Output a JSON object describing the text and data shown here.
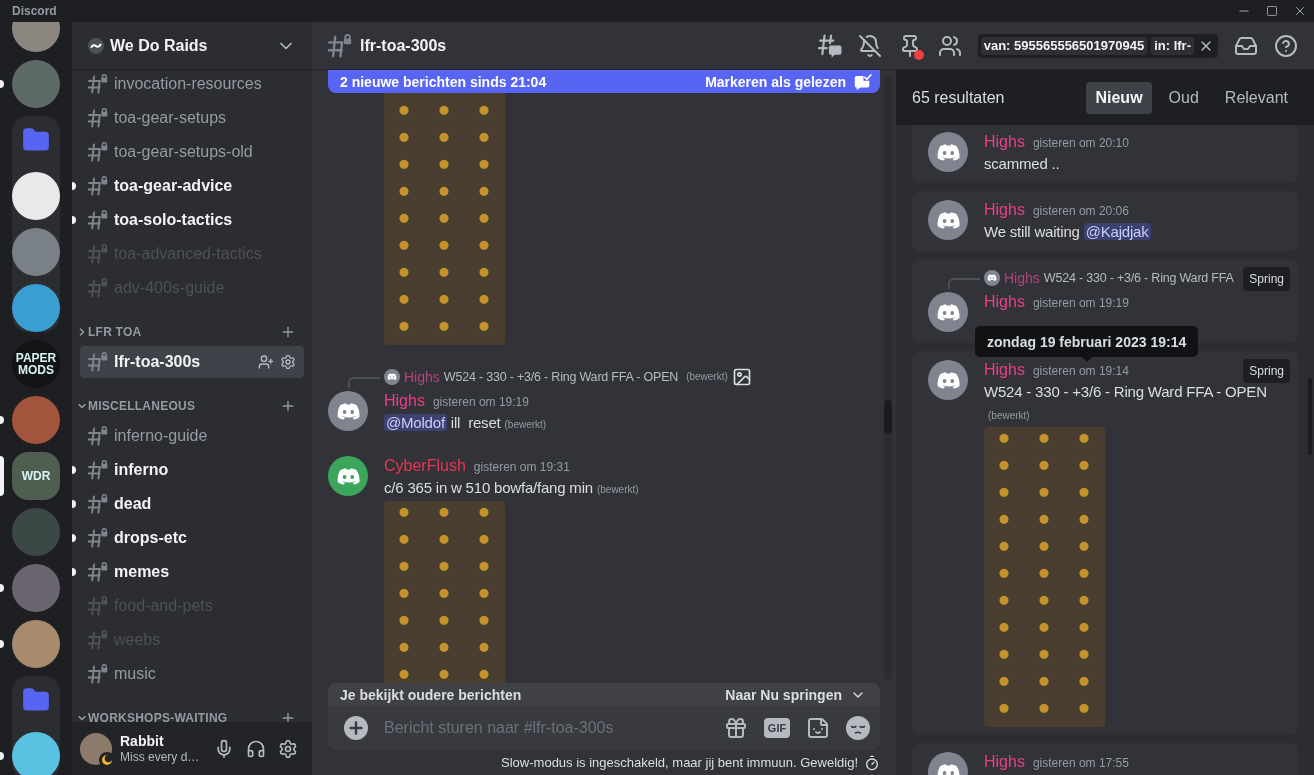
{
  "titlebar": {
    "app_name": "Discord"
  },
  "server_rail": [
    {
      "kind": "server",
      "color": "#8c8680",
      "unread": false,
      "selected": false
    },
    {
      "kind": "server",
      "color": "#5d6b66",
      "unread": true,
      "selected": false
    },
    {
      "kind": "folder",
      "expanded": true,
      "children": [
        {
          "kind": "server",
          "color": "#e9e9e9",
          "unread": false,
          "selected": false
        },
        {
          "kind": "server",
          "color": "#7a8088",
          "unread": false,
          "selected": false
        },
        {
          "kind": "server",
          "color": "#3a9fd0",
          "unread": false,
          "selected": false
        }
      ]
    },
    {
      "kind": "server",
      "color": "#121416",
      "label": "PAPER MODS",
      "unread": false,
      "selected": false
    },
    {
      "kind": "server",
      "color": "#a1553d",
      "unread": true,
      "selected": false
    },
    {
      "kind": "server",
      "color": "#4f5e50",
      "label": "WDR",
      "unread": false,
      "selected": true
    },
    {
      "kind": "server",
      "color": "#3a4846",
      "unread": false,
      "selected": false
    },
    {
      "kind": "server",
      "color": "#6a6470",
      "unread": true,
      "selected": false
    },
    {
      "kind": "server",
      "color": "#a88a6c",
      "unread": true,
      "selected": false
    },
    {
      "kind": "folder",
      "expanded": true,
      "children": [
        {
          "kind": "server",
          "color": "#58c2e0",
          "unread": true,
          "selected": false
        }
      ]
    }
  ],
  "sidebar": {
    "server_name": "We Do Raids",
    "sections": [
      {
        "channels": [
          {
            "name": "invocation-resources",
            "unread": false,
            "muted": false,
            "selected": false
          },
          {
            "name": "toa-gear-setups",
            "unread": false,
            "muted": false,
            "selected": false
          },
          {
            "name": "toa-gear-setups-old",
            "unread": false,
            "muted": false,
            "selected": false
          },
          {
            "name": "toa-gear-advice",
            "unread": true,
            "muted": false,
            "selected": false
          },
          {
            "name": "toa-solo-tactics",
            "unread": true,
            "muted": false,
            "selected": false
          },
          {
            "name": "toa-advanced-tactics",
            "unread": false,
            "muted": true,
            "selected": false
          },
          {
            "name": "adv-400s-guide",
            "unread": false,
            "muted": true,
            "selected": false
          }
        ]
      },
      {
        "category": "LFR TOA",
        "expanded": false,
        "channels": [
          {
            "name": "lfr-toa-300s",
            "unread": false,
            "muted": false,
            "selected": true
          }
        ]
      },
      {
        "category": "MISCELLANEOUS",
        "expanded": true,
        "channels": [
          {
            "name": "inferno-guide",
            "unread": false,
            "muted": false,
            "selected": false
          },
          {
            "name": "inferno",
            "unread": true,
            "muted": false,
            "selected": false
          },
          {
            "name": "dead",
            "unread": true,
            "muted": false,
            "selected": false
          },
          {
            "name": "drops-etc",
            "unread": true,
            "muted": false,
            "selected": false
          },
          {
            "name": "memes",
            "unread": true,
            "muted": false,
            "selected": false
          },
          {
            "name": "food-and-pets",
            "unread": false,
            "muted": true,
            "selected": false
          },
          {
            "name": "weebs",
            "unread": false,
            "muted": true,
            "selected": false
          },
          {
            "name": "music",
            "unread": false,
            "muted": false,
            "selected": false
          }
        ]
      },
      {
        "category": "WORKSHOPS-WAITING",
        "expanded": true
      }
    ]
  },
  "user_panel": {
    "name": "Rabbit",
    "status": "Miss every d…",
    "idle": true,
    "avatar": {
      "color": "#8c7b6b"
    }
  },
  "header": {
    "channel_name": "lfr-toa-300s",
    "pins_unread": true,
    "search_tokens": [
      {
        "key": "van:",
        "value": "595565556501970945"
      },
      {
        "key": "in:",
        "value": "lfr-"
      }
    ]
  },
  "chat": {
    "new_messages_bar": {
      "text": "2 nieuwe berichten sinds 21:04",
      "action": "Markeren als gelezen"
    },
    "messages": [
      {
        "kind": "continuation",
        "image": true
      },
      {
        "kind": "message",
        "reply": {
          "author": "Highs",
          "color": "#b0457a",
          "text": "W524 - 330 - +3/6 - Ring Ward FFA - OPEN",
          "edited_label": "(bewerkt)",
          "image_icon": true
        },
        "avatar": {
          "color": "#80848e"
        },
        "author": "Highs",
        "color": "#eb3f86",
        "time": "gisteren om 19:19",
        "content": [
          {
            "kind": "mention",
            "text": "@Moldof"
          },
          {
            "kind": "text",
            "text": " ill  reset"
          }
        ],
        "edited_label": "(bewerkt)"
      },
      {
        "kind": "message",
        "avatar": {
          "color": "#3ba55c"
        },
        "author": "CyberFlush",
        "color": "#e8374f",
        "time": "gisteren om 19:31",
        "content": [
          {
            "kind": "text",
            "text": "c/6 365 in w 510 bowfa/fang min"
          }
        ],
        "edited_label": "(bewerkt)",
        "image": true
      }
    ],
    "older_messages_bar": {
      "text": "Je bekijkt oudere berichten",
      "action": "Naar Nu springen"
    },
    "composer": {
      "placeholder": "Bericht sturen naar #lfr-toa-300s",
      "gif_label": "GIF"
    },
    "slowmode_notice": "Slow-modus is ingeschakeld, maar jij bent immuun. Geweldig!"
  },
  "search_results": {
    "count": "65 resultaten",
    "sort_tabs": [
      {
        "label": "Nieuw",
        "selected": true
      },
      {
        "label": "Oud",
        "selected": false
      },
      {
        "label": "Relevant",
        "selected": false
      }
    ],
    "results": [
      {
        "kind": "message",
        "avatar": {
          "color": "#80848e"
        },
        "author": "Highs",
        "color": "#eb3f86",
        "time": "gisteren om 20:10",
        "content": [
          {
            "kind": "text",
            "text": "scammed .."
          }
        ]
      },
      {
        "kind": "message",
        "avatar": {
          "color": "#80848e"
        },
        "author": "Highs",
        "color": "#eb3f86",
        "time": "gisteren om 20:06",
        "content": [
          {
            "kind": "text",
            "text": "We still waiting "
          },
          {
            "kind": "mention",
            "text": "@Kajdjak"
          }
        ]
      },
      {
        "kind": "message",
        "reply": {
          "author": "Highs",
          "color": "#b0457a",
          "text": "W524 - 330 - +3/6 - Ring Ward FFA"
        },
        "jump_label": "Spring",
        "avatar": {
          "color": "#80848e"
        },
        "author": "Highs",
        "color": "#eb3f86",
        "time": "gisteren om 19:19"
      },
      {
        "kind": "message",
        "jump_label": "Spring",
        "avatar": {
          "color": "#80848e"
        },
        "author": "Highs",
        "color": "#eb3f86",
        "time": "gisteren om 19:14",
        "content": [
          {
            "kind": "text",
            "text": "W524 - 330 - +3/6 - Ring Ward FFA - OPEN"
          }
        ],
        "edited_label": "(bewerkt)",
        "image": true
      },
      {
        "kind": "message",
        "avatar": {
          "color": "#80848e"
        },
        "author": "Highs",
        "color": "#eb3f86",
        "time": "gisteren om 17:55"
      }
    ],
    "tooltip": "zondag 19 februari 2023 19:14"
  }
}
